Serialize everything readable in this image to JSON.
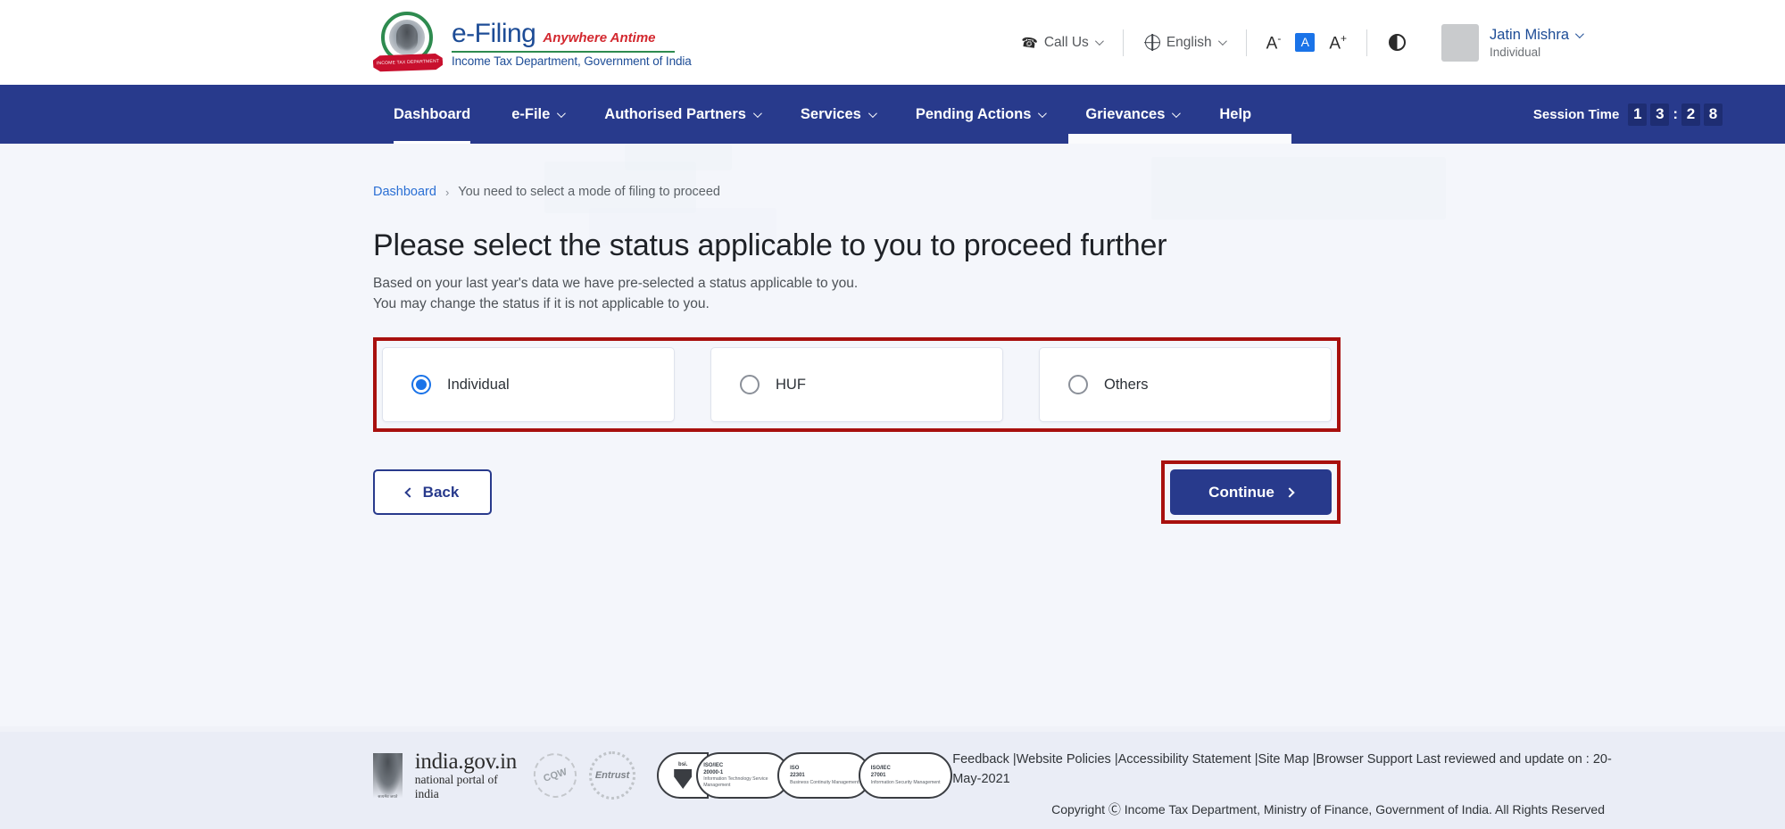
{
  "header": {
    "brand": {
      "title": "e-Filing",
      "tagline": "Anywhere Antime",
      "department": "Income Tax Department, Government of India",
      "emblem_ribbon": "INCOME TAX DEPARTMENT",
      "emblem_icon": "india-national-emblem-icon"
    },
    "call_us": "Call Us",
    "call_us_icon": "phone-icon",
    "language": "English",
    "language_icon": "globe-icon",
    "font_decrease": "A",
    "font_decrease_sup": "-",
    "font_normal": "A",
    "font_increase": "A",
    "font_increase_sup": "+",
    "contrast_icon": "contrast-icon",
    "user": {
      "name": "Jatin Mishra",
      "role": "Individual",
      "avatar_icon": "avatar"
    }
  },
  "nav": {
    "items": [
      {
        "label": "Dashboard",
        "has_caret": false,
        "active": true
      },
      {
        "label": "e-File",
        "has_caret": true,
        "active": false
      },
      {
        "label": "Authorised Partners",
        "has_caret": true,
        "active": false
      },
      {
        "label": "Services",
        "has_caret": true,
        "active": false
      },
      {
        "label": "Pending Actions",
        "has_caret": true,
        "active": false
      },
      {
        "label": "Grievances",
        "has_caret": true,
        "active": false
      },
      {
        "label": "Help",
        "has_caret": false,
        "active": false
      }
    ],
    "session_label": "Session Time",
    "session_digits": [
      "1",
      "3",
      "2",
      "8"
    ],
    "session_colon": ":"
  },
  "breadcrumb": {
    "root": "Dashboard",
    "separator": "›",
    "current": "You need to select a mode of filing to proceed"
  },
  "page": {
    "title": "Please select the status applicable to you to proceed further",
    "subtitle_line1": "Based on your last year's data we have pre-selected a status applicable to you.",
    "subtitle_line2": "You may change the status if it is not applicable to you."
  },
  "status_options": [
    {
      "label": "Individual",
      "selected": true
    },
    {
      "label": "HUF",
      "selected": false
    },
    {
      "label": "Others",
      "selected": false
    }
  ],
  "actions": {
    "back_label": "Back",
    "back_icon": "chevron-left-icon",
    "continue_label": "Continue",
    "continue_icon": "chevron-right-icon"
  },
  "footer": {
    "india_gov_main": "india.gov.in",
    "india_gov_sub": "national portal of india",
    "emblem_icon": "india-national-emblem-icon",
    "seal_cqw": "CQW",
    "seal_entrust": "Entrust",
    "iso_badges": [
      {
        "code": "bsi.",
        "standard": "",
        "desc": ""
      },
      {
        "code": "ISO/IEC",
        "standard": "20000-1",
        "desc": "Information Technology Service Management"
      },
      {
        "code": "ISO",
        "standard": "22301",
        "desc": "Business Continuity Management"
      },
      {
        "code": "ISO/IEC",
        "standard": "27001",
        "desc": "Information Security Management"
      }
    ],
    "links": [
      "Feedback",
      "Website Policies",
      "Accessibility Statement",
      "Site Map",
      "Browser Support"
    ],
    "last_reviewed": "Last reviewed and update on : 20-May-2021",
    "copyright": "Copyright Ⓒ Income Tax Department, Ministry of Finance, Government of India. All Rights Reserved"
  },
  "colors": {
    "nav_blue": "#283a8c",
    "brand_blue": "#1d4c96",
    "accent_red": "#d3282f",
    "highlight_red": "#a8100e",
    "link_blue": "#2a6fd4",
    "radio_blue": "#1a73e8",
    "page_bg": "#f4f6fb",
    "footer_bg": "#eaedf6"
  }
}
